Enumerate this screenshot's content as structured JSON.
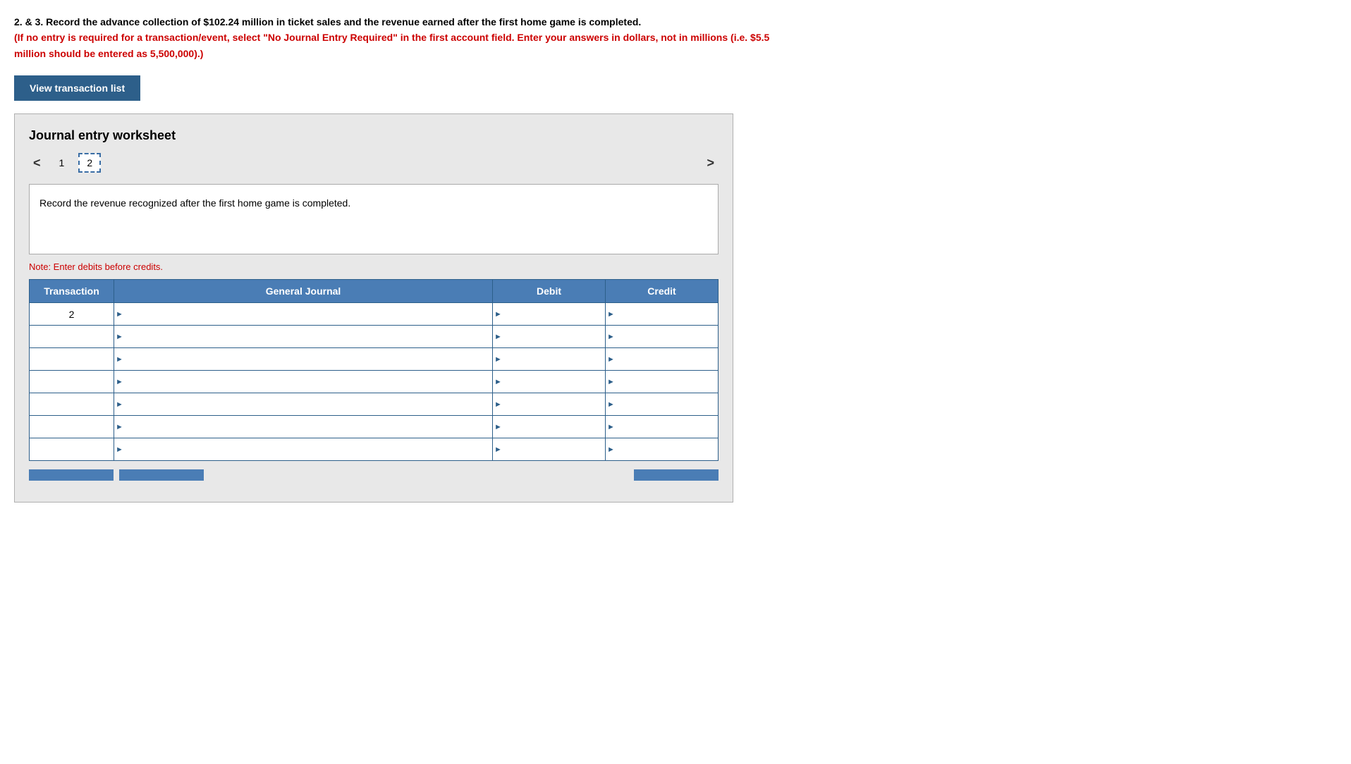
{
  "instructions": {
    "line1": "2. & 3. Record the advance collection of $102.24 million in ticket sales and the revenue earned after the first home game is completed.",
    "line1_bold_prefix": "2. & 3.",
    "line2": "(If no entry is required for a transaction/event, select \"No Journal Entry Required\" in the first account field. Enter your answers in dollars, not in millions (i.e. $5.5 million should be entered as 5,500,000).)",
    "line2_red": true
  },
  "view_transaction_btn": "View transaction list",
  "worksheet": {
    "title": "Journal entry worksheet",
    "tabs": [
      {
        "number": "1",
        "active": false
      },
      {
        "number": "2",
        "active": true
      }
    ],
    "description": "Record the revenue recognized after the first home game is completed.",
    "note": "Note: Enter debits before credits.",
    "table": {
      "headers": [
        "Transaction",
        "General Journal",
        "Debit",
        "Credit"
      ],
      "rows": [
        {
          "transaction": "2",
          "journal": "",
          "debit": "",
          "credit": ""
        },
        {
          "transaction": "",
          "journal": "",
          "debit": "",
          "credit": ""
        },
        {
          "transaction": "",
          "journal": "",
          "debit": "",
          "credit": ""
        },
        {
          "transaction": "",
          "journal": "",
          "debit": "",
          "credit": ""
        },
        {
          "transaction": "",
          "journal": "",
          "debit": "",
          "credit": ""
        },
        {
          "transaction": "",
          "journal": "",
          "debit": "",
          "credit": ""
        },
        {
          "transaction": "",
          "journal": "",
          "debit": "",
          "credit": ""
        }
      ]
    }
  },
  "bottom_buttons": [
    "",
    "",
    "",
    ""
  ],
  "nav": {
    "prev": "<",
    "next": ">"
  }
}
